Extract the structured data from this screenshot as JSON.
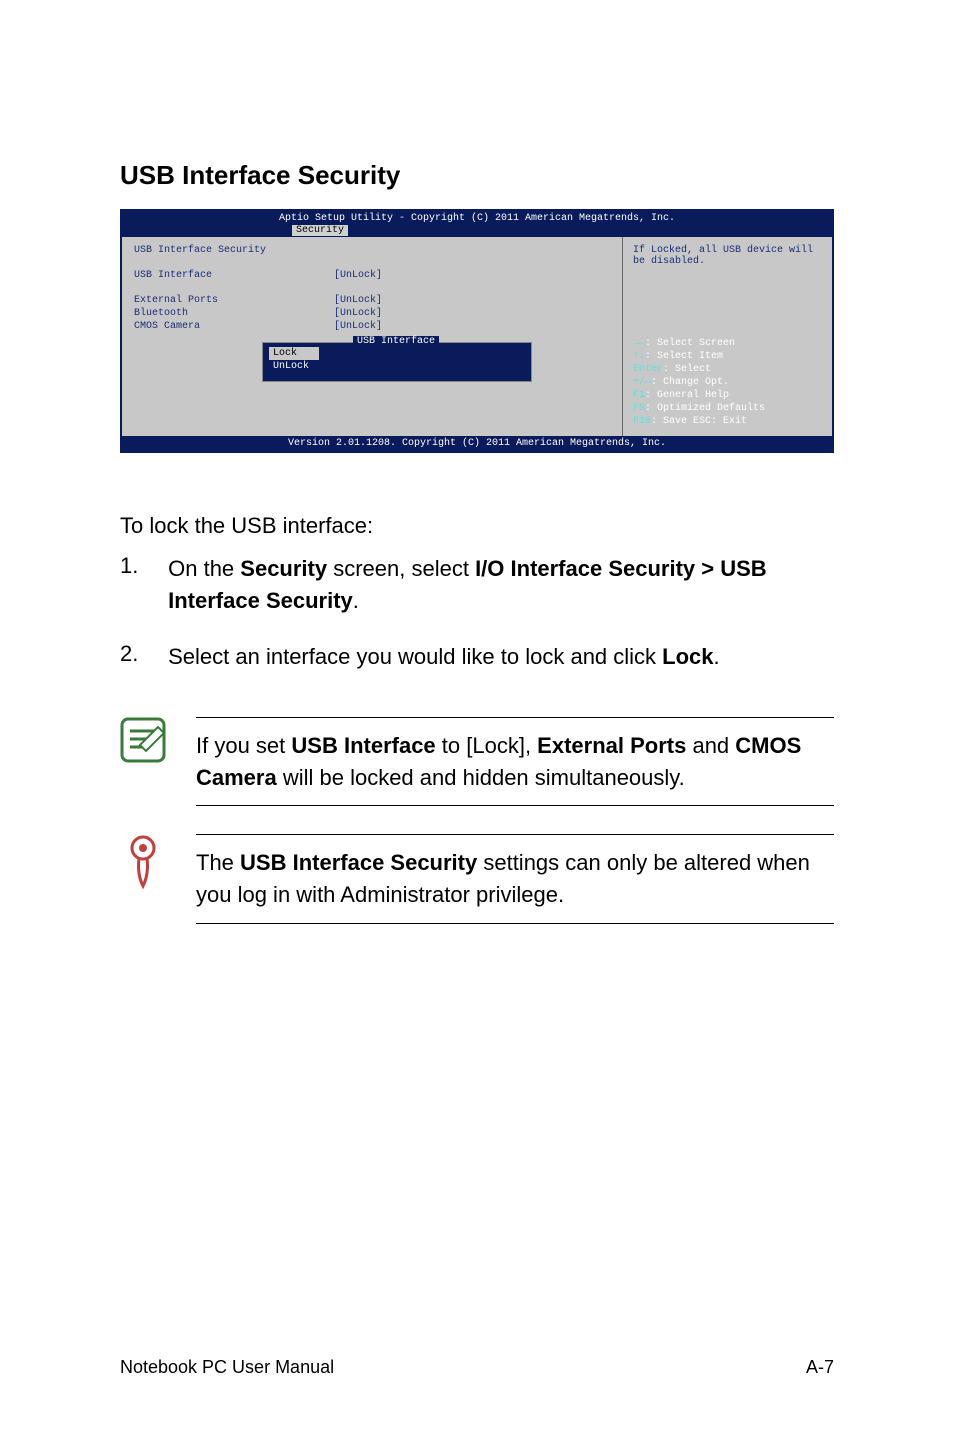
{
  "section_title": "USB Interface Security",
  "bios": {
    "header": "Aptio Setup Utility - Copyright (C) 2011 American Megatrends, Inc.",
    "tab": "Security",
    "left_title": "USB Interface Security",
    "rows": [
      {
        "label": "USB Interface",
        "value": "[UnLock]"
      },
      {
        "label": "External Ports",
        "value": "[UnLock]"
      },
      {
        "label": "Bluetooth",
        "value": "[UnLock]"
      },
      {
        "label": "CMOS Camera",
        "value": "[UnLock]"
      }
    ],
    "popup": {
      "title": "USB Interface",
      "items": [
        "Lock",
        "UnLock"
      ],
      "selected": "Lock"
    },
    "right_desc": "If Locked, all USB device will be disabled.",
    "help": [
      {
        "key": "→←",
        "text": ": Select Screen"
      },
      {
        "key": "↑↓",
        "text": ": Select Item"
      },
      {
        "key": "Enter",
        "text": ": Select"
      },
      {
        "key": "+/—",
        "text": ": Change Opt."
      },
      {
        "key": "F1",
        "text": ": General Help"
      },
      {
        "key": "F9",
        "text": ": Optimized Defaults"
      },
      {
        "key": "F10",
        "text": ": Save   ESC: Exit"
      }
    ],
    "footer": "Version 2.01.1208. Copyright (C) 2011 American Megatrends, Inc."
  },
  "intro": "To lock the USB interface:",
  "steps": [
    {
      "num": "1.",
      "pre": "On the ",
      "b1": "Security",
      "mid": " screen, select ",
      "b2": "I/O Interface Security > USB Interface Security",
      "post": "."
    },
    {
      "num": "2.",
      "pre": "Select an interface you would like to lock and click ",
      "b1": "Lock",
      "mid": "",
      "b2": "",
      "post": "."
    }
  ],
  "note1": {
    "pre": "If you set ",
    "b1": "USB Interface",
    "mid1": " to [Lock], ",
    "b2": "External Ports",
    "mid2": " and ",
    "b3": "CMOS Camera",
    "post": " will be locked and hidden simultaneously."
  },
  "note2": {
    "pre": "The ",
    "b1": "USB Interface Security",
    "post": " settings can only be altered when you log in with Administrator privilege."
  },
  "footer": {
    "left": "Notebook PC User Manual",
    "right": "A-7"
  }
}
